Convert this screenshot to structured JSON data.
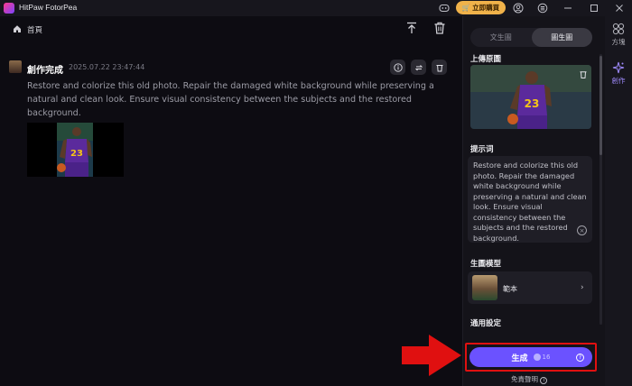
{
  "app": {
    "title": "HitPaw FotorPea"
  },
  "titlebar": {
    "buy_label": "立即購買",
    "icons": [
      "discord-icon",
      "account-icon",
      "settings-icon",
      "minimize-icon",
      "maximize-icon",
      "close-icon"
    ]
  },
  "breadcrumb": {
    "home": "首頁"
  },
  "result": {
    "status": "創作完成",
    "timestamp": "2025.07.22  23:47:44",
    "prompt": "Restore and colorize this old photo. Repair the damaged white background while preserving a natural and clean look. Ensure visual consistency between the subjects and the restored background.",
    "jersey_number": "23"
  },
  "panel": {
    "tabs": [
      {
        "label": "文生圖"
      },
      {
        "label": "圖生圖"
      }
    ],
    "upload_label": "上傳原圖",
    "prompt_label": "提示词",
    "prompt_text": "Restore and colorize this old photo. Repair the damaged white background while preserving a natural and clean look. Ensure visual consistency between the subjects and the restored background.",
    "model_label": "生圖模型",
    "model_name": "範本",
    "settings_label": "通用設定",
    "generate_label": "生成",
    "credits": "16",
    "disclaimer": "免責聲明"
  },
  "rail": {
    "items": [
      {
        "label": "方塊"
      },
      {
        "label": "創作"
      }
    ]
  },
  "colors": {
    "accent": "#6b52ff",
    "buy": "#f0b24a",
    "highlight": "#e01010"
  }
}
